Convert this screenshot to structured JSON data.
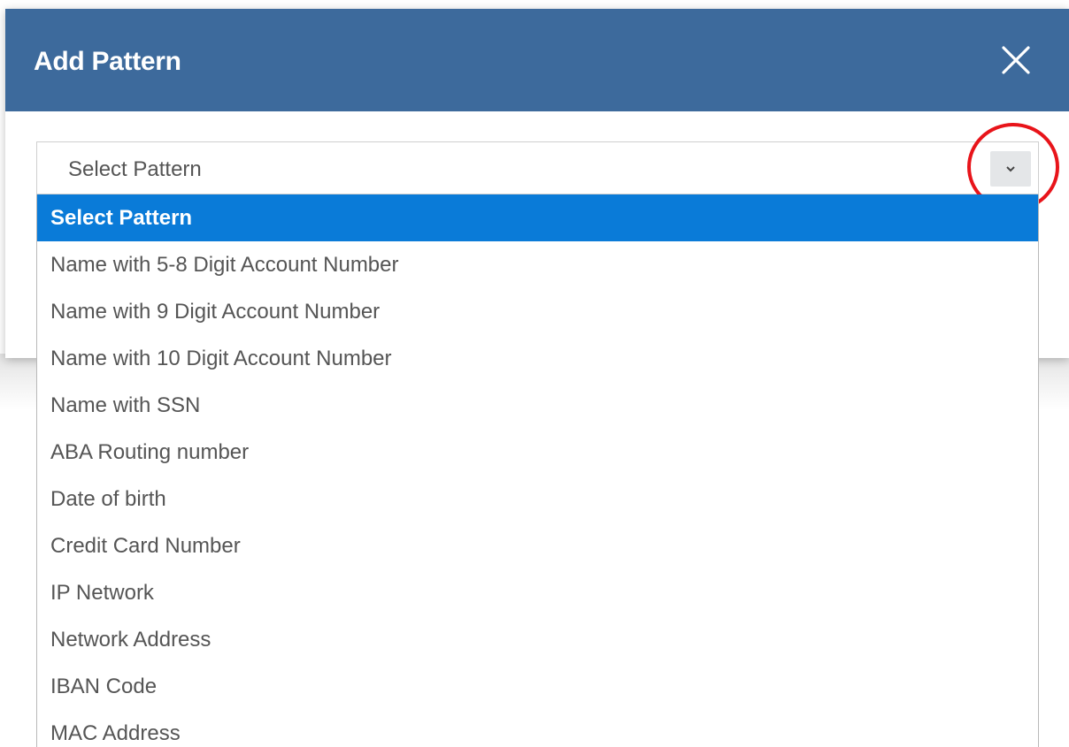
{
  "dialog": {
    "title": "Add Pattern",
    "close_icon": "close-icon"
  },
  "select": {
    "value": "Select Pattern",
    "toggle_icon": "chevron-down-icon"
  },
  "dropdown": {
    "options": [
      "Select Pattern",
      "Name with 5-8 Digit Account Number",
      "Name with 9 Digit Account Number",
      "Name with 10 Digit Account Number",
      "Name with SSN",
      "ABA Routing number",
      "Date of birth",
      "Credit Card Number",
      "IP Network",
      "Network Address",
      "IBAN Code",
      "MAC Address"
    ],
    "highlighted_index": 0
  },
  "colors": {
    "header": "#3d6a9c",
    "highlight": "#0a7bd8",
    "annotation_ring": "#e8141a"
  }
}
